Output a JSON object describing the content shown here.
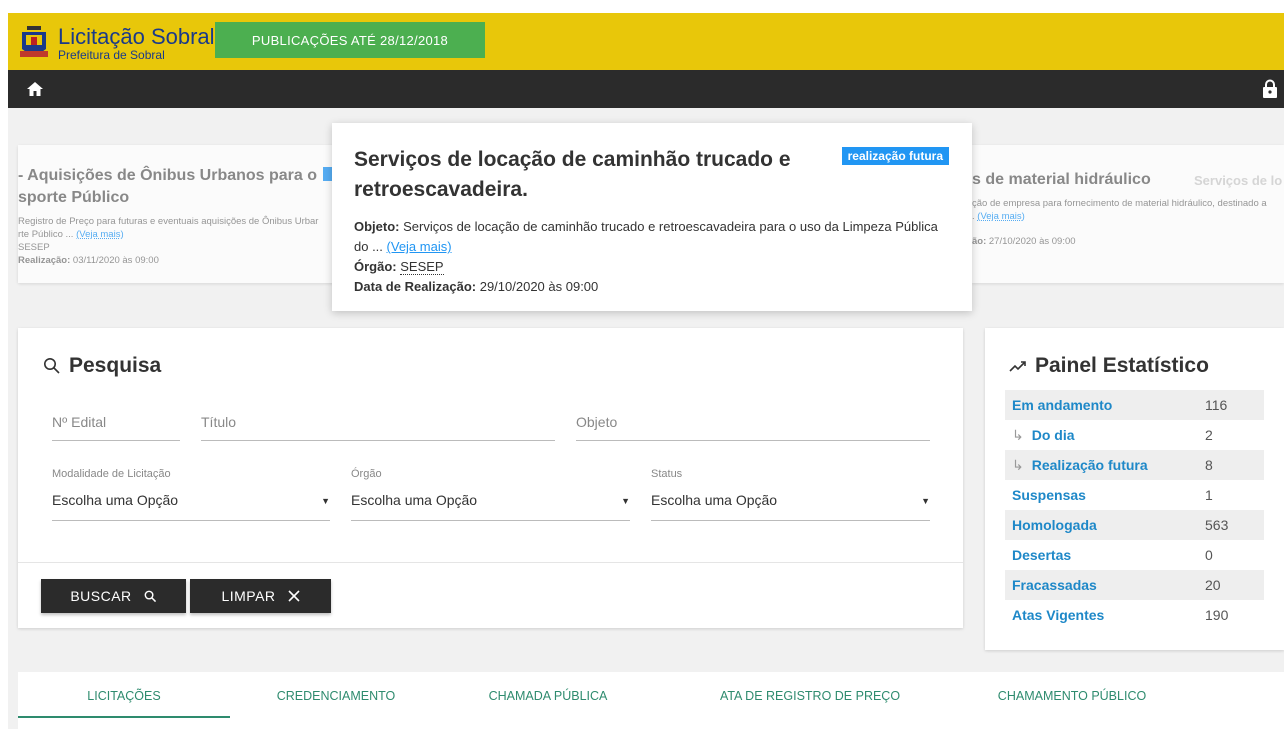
{
  "header": {
    "title": "Licitação Sobral",
    "subtitle": "Prefeitura de Sobral",
    "publications_button": "PUBLICAÇÕES ATÉ 28/12/2018",
    "colors": {
      "yellow": "#e8c70a",
      "green": "#4caf50",
      "dark": "#2b2b2b"
    }
  },
  "nav": {
    "home_icon": "home-icon",
    "lock_icon": "lock-icon"
  },
  "carousel": {
    "left": {
      "title_l1": "- Aquisições de Ônibus Urbanos para o",
      "title_l2": "sporte Público",
      "line1": "Registro de Preço para futuras e eventuais aquisições de Ônibus Urbar",
      "line2": "rte Público ... ",
      "link": "(Veja mais)",
      "orgao": "SESEP",
      "realizacao_label": "Realização:",
      "realizacao": "03/11/2020 às 09:00"
    },
    "main": {
      "title": "Serviços de locação de caminhão trucado e retroescavadeira.",
      "badge": "realização futura",
      "objeto_label": "Objeto:",
      "objeto": " Serviços de locação de caminhão trucado e retroescavadeira para o uso da Limpeza Pública do ... ",
      "link": "(Veja mais)",
      "orgao_label": "Órgão:",
      "orgao": "SESEP",
      "data_label": "Data de Realização:",
      "data": " 29/10/2020 às 09:00"
    },
    "right": {
      "title": "s de material hidráulico",
      "line1": "ção de empresa para fornecimento de material hidráulico, destinado a",
      "link": "(Veja mais)",
      "realizacao_label": "ão:",
      "realizacao": "27/10/2020 às 09:00",
      "far_title": "Serviços de lo"
    }
  },
  "search": {
    "title": "Pesquisa",
    "edital_placeholder": "Nº Edital",
    "titulo_placeholder": "Título",
    "objeto_placeholder": "Objeto",
    "modalidade_label": "Modalidade de Licitação",
    "orgao_label": "Órgão",
    "status_label": "Status",
    "select_value": "Escolha uma Opção",
    "buscar": "BUSCAR",
    "limpar": "LIMPAR"
  },
  "stats": {
    "title": "Painel Estatístico",
    "rows": [
      {
        "label": "Em andamento",
        "value": "116"
      },
      {
        "label": "Do dia",
        "value": "2"
      },
      {
        "label": "Realização futura",
        "value": "8"
      },
      {
        "label": "Suspensas",
        "value": "1"
      },
      {
        "label": "Homologada",
        "value": "563"
      },
      {
        "label": "Desertas",
        "value": "0"
      },
      {
        "label": "Fracassadas",
        "value": "20"
      },
      {
        "label": "Atas Vigentes",
        "value": "190"
      }
    ]
  },
  "tabs": [
    "LICITAÇÕES",
    "CREDENCIAMENTO",
    "CHAMADA PÚBLICA",
    "ATA DE REGISTRO DE PREÇO",
    "CHAMAMENTO PÚBLICO"
  ]
}
